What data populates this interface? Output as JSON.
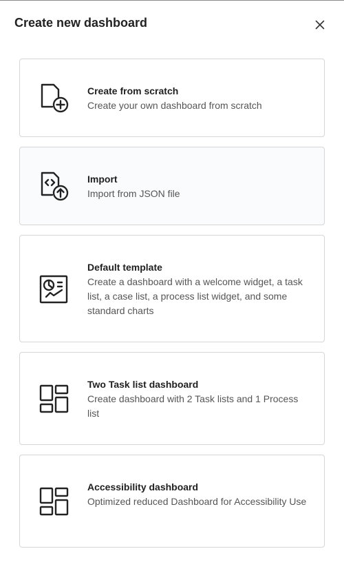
{
  "dialog": {
    "title": "Create new dashboard",
    "close_icon": "close-icon"
  },
  "options": [
    {
      "title": "Create from scratch",
      "description": "Create your own dashboard from scratch",
      "icon": "file-add-icon"
    },
    {
      "title": "Import",
      "description": "Import from JSON file",
      "icon": "file-code-upload-icon"
    },
    {
      "title": "Default template",
      "description": "Create a dashboard with a welcome widget, a task list, a case list, a process list widget, and some standard charts",
      "icon": "report-chart-icon"
    },
    {
      "title": "Two Task list dashboard",
      "description": "Create dashboard with 2 Task lists and 1 Process list",
      "icon": "layout-grid-icon"
    },
    {
      "title": "Accessibility dashboard",
      "description": "Optimized reduced Dashboard for Accessibility Use",
      "icon": "layout-grid-icon"
    }
  ]
}
